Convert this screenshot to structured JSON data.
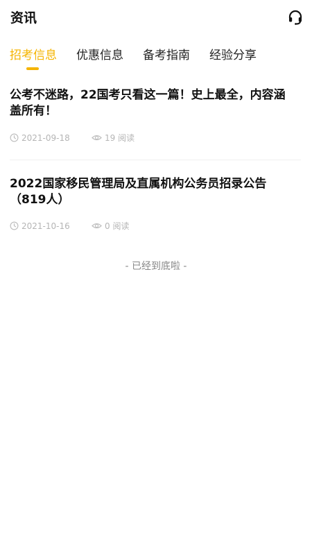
{
  "header": {
    "title": "资讯",
    "support_icon": "headset-icon"
  },
  "tabs": [
    {
      "label": "招考信息",
      "active": true
    },
    {
      "label": "优惠信息",
      "active": false
    },
    {
      "label": "备考指南",
      "active": false
    },
    {
      "label": "经验分享",
      "active": false
    }
  ],
  "colors": {
    "accent": "#f5b400",
    "meta": "#b5b5b5"
  },
  "articles": [
    {
      "title_line1": "公考不迷路，22国考只看这一篇！史上最全，内容涵",
      "title_line2": "盖所有！",
      "date": "2021-09-18",
      "reads": "19 阅读",
      "date_icon": "clock-icon",
      "reads_icon": "eye-icon"
    },
    {
      "title_line1": "2022国家移民管理局及直属机构公务员招录公告",
      "title_line2": "（819人）",
      "date": "2021-10-16",
      "reads": "0 阅读",
      "date_icon": "clock-icon",
      "reads_icon": "eye-icon"
    }
  ],
  "footer": {
    "end_text": "- 已经到底啦 -"
  }
}
